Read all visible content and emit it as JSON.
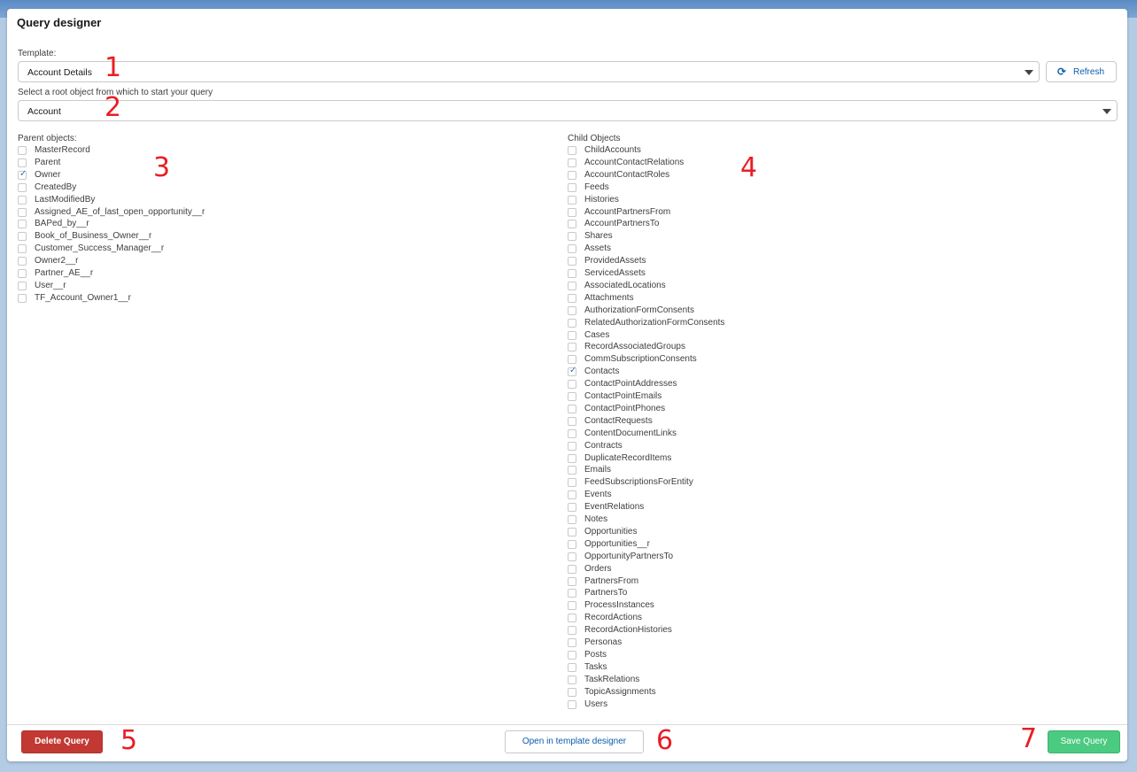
{
  "header": {
    "title": "Query designer"
  },
  "template": {
    "label": "Template:",
    "value": "Account Details",
    "refresh_label": "Refresh"
  },
  "root_object": {
    "label": "Select a root object from which to start your query",
    "value": "Account"
  },
  "parent_objects": {
    "heading": "Parent objects:",
    "items": [
      {
        "label": "MasterRecord",
        "checked": false
      },
      {
        "label": "Parent",
        "checked": false
      },
      {
        "label": "Owner",
        "checked": true
      },
      {
        "label": "CreatedBy",
        "checked": false
      },
      {
        "label": "LastModifiedBy",
        "checked": false
      },
      {
        "label": "Assigned_AE_of_last_open_opportunity__r",
        "checked": false
      },
      {
        "label": "BAPed_by__r",
        "checked": false
      },
      {
        "label": "Book_of_Business_Owner__r",
        "checked": false
      },
      {
        "label": "Customer_Success_Manager__r",
        "checked": false
      },
      {
        "label": "Owner2__r",
        "checked": false
      },
      {
        "label": "Partner_AE__r",
        "checked": false
      },
      {
        "label": "User__r",
        "checked": false
      },
      {
        "label": "TF_Account_Owner1__r",
        "checked": false
      }
    ]
  },
  "child_objects": {
    "heading": "Child Objects",
    "items": [
      {
        "label": "ChildAccounts",
        "checked": false
      },
      {
        "label": "AccountContactRelations",
        "checked": false
      },
      {
        "label": "AccountContactRoles",
        "checked": false
      },
      {
        "label": "Feeds",
        "checked": false
      },
      {
        "label": "Histories",
        "checked": false
      },
      {
        "label": "AccountPartnersFrom",
        "checked": false
      },
      {
        "label": "AccountPartnersTo",
        "checked": false
      },
      {
        "label": "Shares",
        "checked": false
      },
      {
        "label": "Assets",
        "checked": false
      },
      {
        "label": "ProvidedAssets",
        "checked": false
      },
      {
        "label": "ServicedAssets",
        "checked": false
      },
      {
        "label": "AssociatedLocations",
        "checked": false
      },
      {
        "label": "Attachments",
        "checked": false
      },
      {
        "label": "AuthorizationFormConsents",
        "checked": false
      },
      {
        "label": "RelatedAuthorizationFormConsents",
        "checked": false
      },
      {
        "label": "Cases",
        "checked": false
      },
      {
        "label": "RecordAssociatedGroups",
        "checked": false
      },
      {
        "label": "CommSubscriptionConsents",
        "checked": false
      },
      {
        "label": "Contacts",
        "checked": true
      },
      {
        "label": "ContactPointAddresses",
        "checked": false
      },
      {
        "label": "ContactPointEmails",
        "checked": false
      },
      {
        "label": "ContactPointPhones",
        "checked": false
      },
      {
        "label": "ContactRequests",
        "checked": false
      },
      {
        "label": "ContentDocumentLinks",
        "checked": false
      },
      {
        "label": "Contracts",
        "checked": false
      },
      {
        "label": "DuplicateRecordItems",
        "checked": false
      },
      {
        "label": "Emails",
        "checked": false
      },
      {
        "label": "FeedSubscriptionsForEntity",
        "checked": false
      },
      {
        "label": "Events",
        "checked": false
      },
      {
        "label": "EventRelations",
        "checked": false
      },
      {
        "label": "Notes",
        "checked": false
      },
      {
        "label": "Opportunities",
        "checked": false
      },
      {
        "label": "Opportunities__r",
        "checked": false
      },
      {
        "label": "OpportunityPartnersTo",
        "checked": false
      },
      {
        "label": "Orders",
        "checked": false
      },
      {
        "label": "PartnersFrom",
        "checked": false
      },
      {
        "label": "PartnersTo",
        "checked": false
      },
      {
        "label": "ProcessInstances",
        "checked": false
      },
      {
        "label": "RecordActions",
        "checked": false
      },
      {
        "label": "RecordActionHistories",
        "checked": false
      },
      {
        "label": "Personas",
        "checked": false
      },
      {
        "label": "Posts",
        "checked": false
      },
      {
        "label": "Tasks",
        "checked": false
      },
      {
        "label": "TaskRelations",
        "checked": false
      },
      {
        "label": "TopicAssignments",
        "checked": false
      },
      {
        "label": "Users",
        "checked": false
      }
    ]
  },
  "footer": {
    "delete_label": "Delete Query",
    "open_label": "Open in template designer",
    "save_label": "Save Query"
  },
  "annotations": [
    "1",
    "2",
    "3",
    "4",
    "5",
    "6",
    "7"
  ],
  "colors": {
    "delete": "#c23934",
    "save": "#4bca81",
    "annotation": "#e81e25",
    "link": "#0b5cab"
  }
}
